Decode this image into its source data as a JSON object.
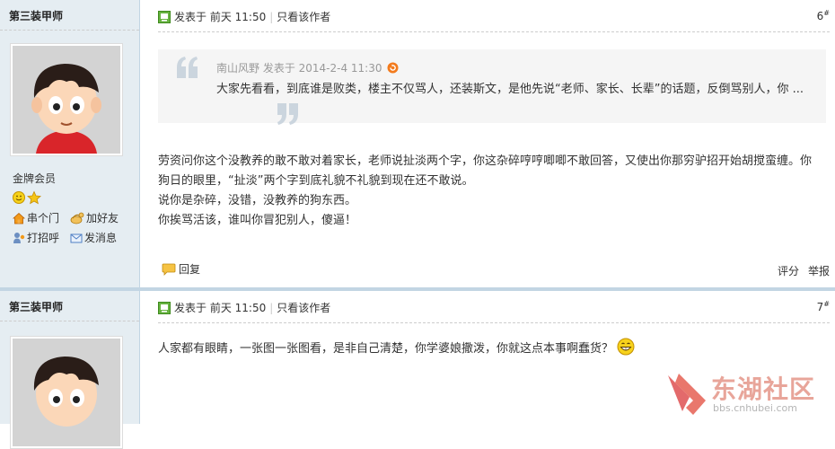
{
  "posts": [
    {
      "author": "第三装甲师",
      "group": "金牌会员",
      "links": [
        "串个门",
        "加好友",
        "打招呼",
        "发消息"
      ],
      "meta": {
        "posted": "发表于",
        "time": "前天 11:50",
        "only_author": "只看该作者"
      },
      "floor": "6",
      "floor_sup": "#",
      "quote": {
        "header": "南山风野 发表于 2014-2-4 11:30",
        "text": "大家先看看，到底谁是败类，楼主不仅骂人，还装斯文，是他先说“老师、家长、长辈”的话题，反倒骂别人，你 ..."
      },
      "body_lines": [
        "劳资问你这个没教养的敢不敢对着家长，老师说扯淡两个字，你这杂碎哼哼唧唧不敢回答，又使出你那穷驴招开始胡搅蛮缠。你狗日的眼里，“扯淡”两个字到底礼貌不礼貌到现在还不敢说。",
        "说你是杂碎，没错，没教养的狗东西。",
        "你挨骂活该，谁叫你冒犯别人，傻逼！"
      ],
      "footer": {
        "reply": "回复",
        "rate": "评分",
        "report": "举报"
      }
    },
    {
      "author": "第三装甲师",
      "meta": {
        "posted": "发表于",
        "time": "前天 11:50",
        "only_author": "只看该作者"
      },
      "floor": "7",
      "floor_sup": "#",
      "body_lines": [
        "人家都有眼睛，一张图一张图看，是非自己清楚，你学婆娘撒泼，你就这点本事啊蠢货？"
      ]
    }
  ],
  "watermark": {
    "title": "东湖社区",
    "url": "bbs.cnhubei.com"
  },
  "colors": {
    "sidebar": "#e5edf2",
    "border": "#c2d5e3",
    "watermark": "#e8a59a"
  },
  "icons": [
    "online-icon",
    "smile-icon",
    "star-icon",
    "home-icon",
    "add-friend-icon",
    "greet-icon",
    "message-icon",
    "quote-open-icon",
    "quote-close-icon",
    "go-icon",
    "reply-icon",
    "grin-icon"
  ]
}
